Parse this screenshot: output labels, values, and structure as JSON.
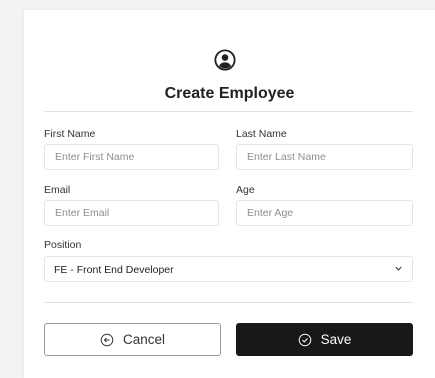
{
  "form": {
    "title": "Create Employee",
    "fields": {
      "first_name": {
        "label": "First Name",
        "placeholder": "Enter First Name"
      },
      "last_name": {
        "label": "Last Name",
        "placeholder": "Enter Last Name"
      },
      "email": {
        "label": "Email",
        "placeholder": "Enter Email"
      },
      "age": {
        "label": "Age",
        "placeholder": "Enter Age"
      },
      "position": {
        "label": "Position",
        "selected": "FE - Front End Developer"
      }
    },
    "buttons": {
      "cancel": "Cancel",
      "save": "Save"
    },
    "icons": {
      "header": "user-circle-icon",
      "cancel": "arrow-left-circle-icon",
      "save": "check-circle-icon",
      "select": "chevron-down-icon"
    },
    "colors": {
      "save_bg": "#18181b",
      "page_bg": "#f3f3f4"
    }
  }
}
